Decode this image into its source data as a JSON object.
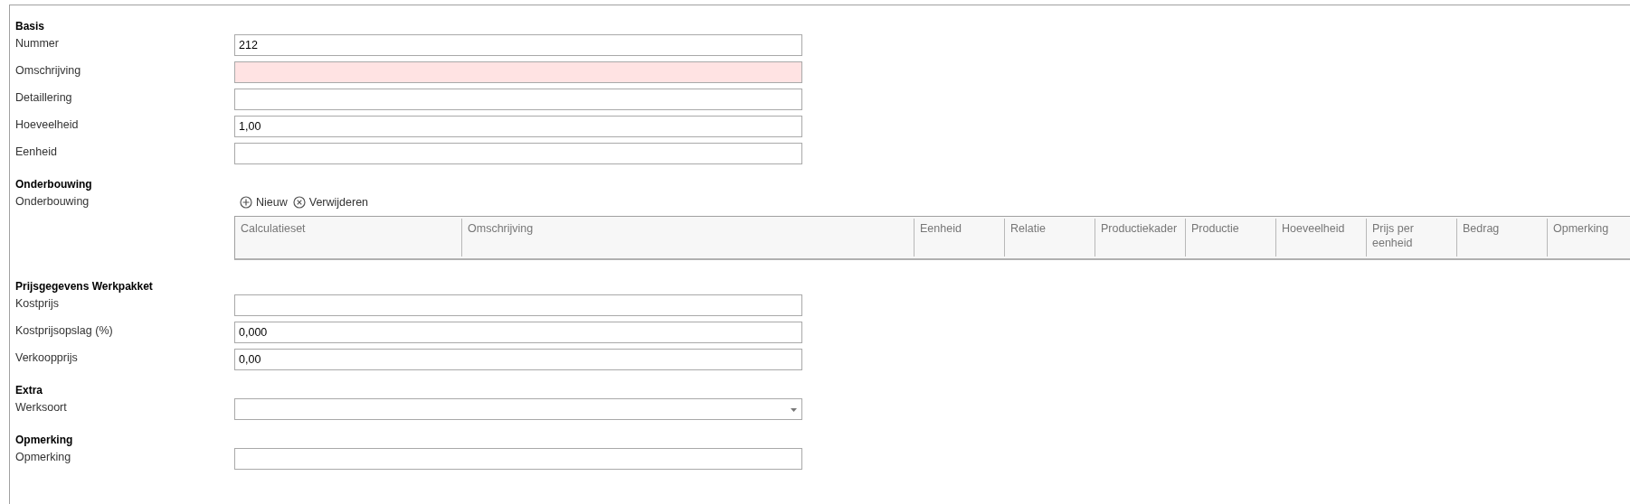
{
  "sections": [
    {
      "heading": "Basis",
      "items": [
        {
          "kind": "text",
          "label": "Nummer",
          "value": "212",
          "invalid": false
        },
        {
          "kind": "text",
          "label": "Omschrijving",
          "invalid": true
        },
        {
          "kind": "text",
          "label": "Detaillering",
          "invalid": false
        },
        {
          "kind": "text",
          "label": "Hoeveelheid",
          "value": "1,00",
          "invalid": false
        },
        {
          "kind": "text",
          "label": "Eenheid",
          "invalid": false
        }
      ]
    },
    {
      "heading": "Onderbouwing",
      "items": [
        {
          "kind": "grid",
          "label": "Onderbouwing",
          "toolbar": [
            {
              "kind": "add",
              "label": "Nieuw"
            },
            {
              "kind": "remove",
              "label": "Verwijderen"
            }
          ],
          "columns": [
            "Calculatieset",
            "Omschrijving",
            "Eenheid",
            "Relatie",
            "Productiekader",
            "Productie",
            "Hoeveelheid",
            "Prijs per eenheid",
            "Bedrag",
            "Opmerking"
          ]
        }
      ]
    },
    {
      "heading": "Prijsgegevens Werkpakket",
      "items": [
        {
          "kind": "text",
          "label": "Kostprijs",
          "invalid": false
        },
        {
          "kind": "text",
          "label": "Kostprijsopslag (%)",
          "value": "0,000",
          "invalid": false
        },
        {
          "kind": "text",
          "label": "Verkoopprijs",
          "value": "0,00",
          "invalid": false
        }
      ]
    },
    {
      "heading": "Extra",
      "items": [
        {
          "kind": "dropdown",
          "label": "Werksoort",
          "invalid": false
        }
      ]
    },
    {
      "heading": "Opmerking",
      "items": [
        {
          "kind": "text",
          "label": "Opmerking",
          "invalid": false
        }
      ]
    }
  ]
}
